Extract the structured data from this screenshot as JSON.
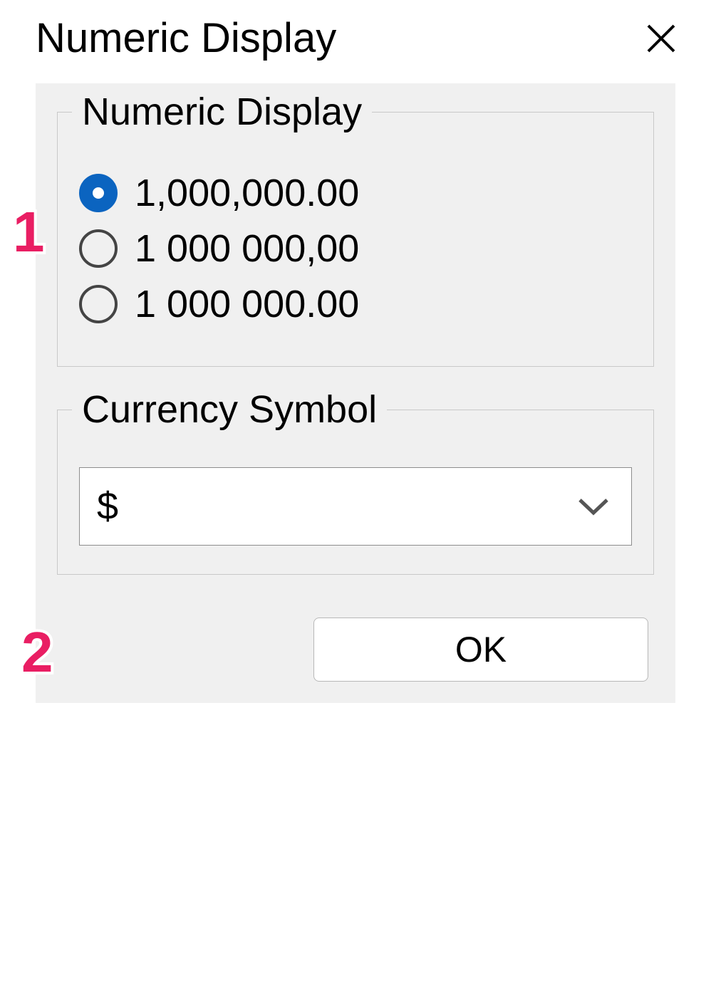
{
  "dialog": {
    "title": "Numeric Display",
    "close_icon": "close"
  },
  "numeric_group": {
    "legend": "Numeric Display",
    "options": [
      {
        "label": "1,000,000.00",
        "selected": true
      },
      {
        "label": "1 000 000,00",
        "selected": false
      },
      {
        "label": "1 000 000.00",
        "selected": false
      }
    ]
  },
  "currency_group": {
    "legend": "Currency Symbol",
    "selected_value": "$"
  },
  "buttons": {
    "ok_label": "OK"
  },
  "callouts": {
    "one": "1",
    "two": "2"
  }
}
